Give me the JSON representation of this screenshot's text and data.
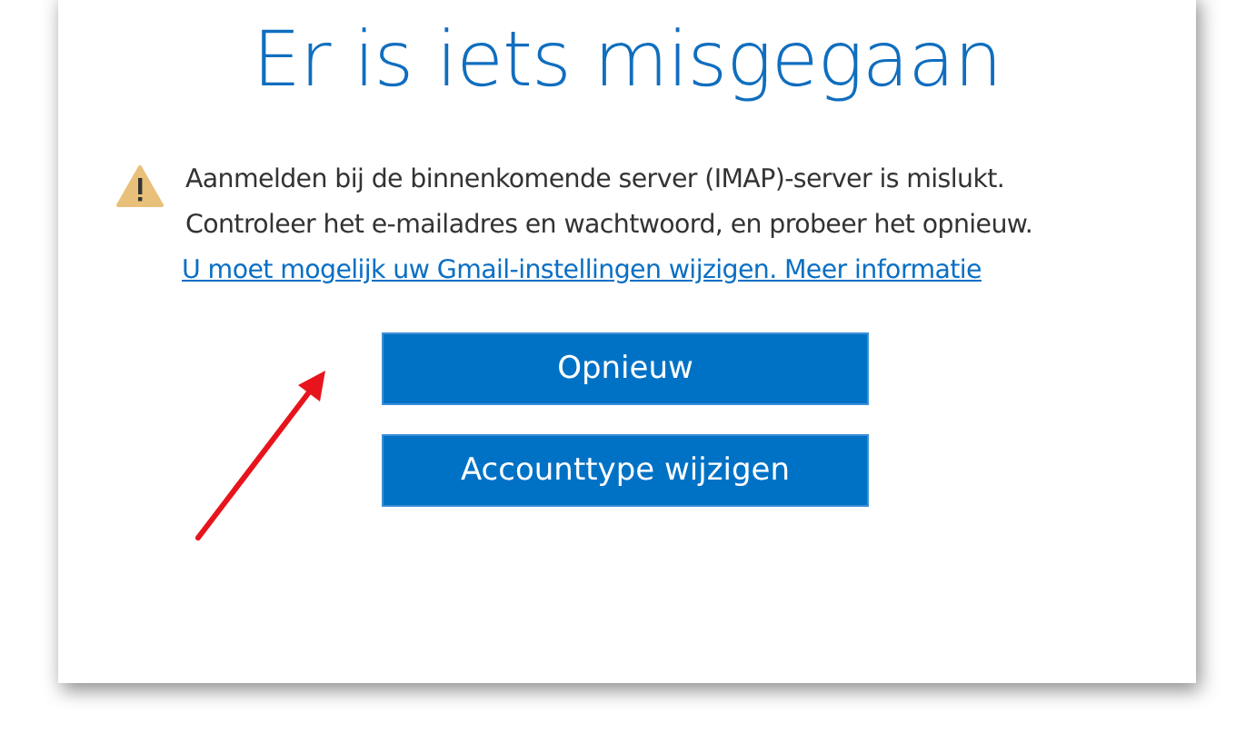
{
  "title": "Er is iets misgegaan",
  "message": {
    "lines": [
      "Aanmelden bij de binnenkomende server (IMAP)-server is mislukt.",
      "Controleer het e-mailadres en wachtwoord, en probeer het opnieuw."
    ]
  },
  "link": "U moet mogelijk uw Gmail-instellingen wijzigen. Meer informatie",
  "buttons": [
    "Opnieuw",
    "Accounttype wijzigen"
  ]
}
